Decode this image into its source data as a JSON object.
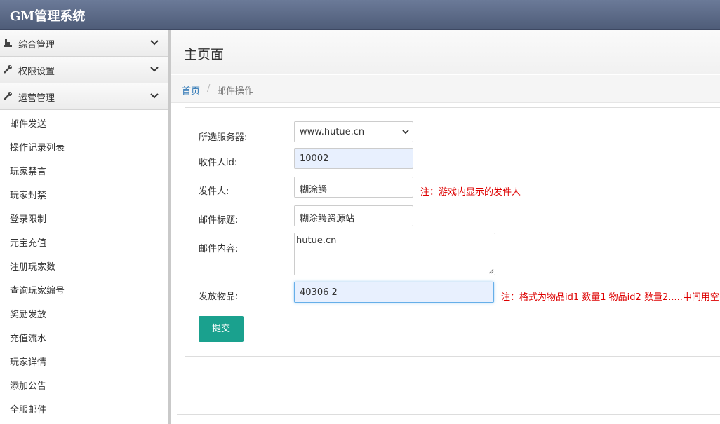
{
  "app": {
    "title": "GM管理系统"
  },
  "sidebar": {
    "groups": [
      {
        "label": "综合管理",
        "icon": "dashboard-icon"
      },
      {
        "label": "权限设置",
        "icon": "wrench-icon"
      },
      {
        "label": "运营管理",
        "icon": "wrench-icon"
      }
    ],
    "items": [
      {
        "label": "邮件发送"
      },
      {
        "label": "操作记录列表"
      },
      {
        "label": "玩家禁言"
      },
      {
        "label": "玩家封禁"
      },
      {
        "label": "登录限制"
      },
      {
        "label": "元宝充值"
      },
      {
        "label": "注册玩家数"
      },
      {
        "label": "查询玩家编号"
      },
      {
        "label": "奖励发放"
      },
      {
        "label": "充值流水"
      },
      {
        "label": "玩家详情"
      },
      {
        "label": "添加公告"
      },
      {
        "label": "全服邮件"
      }
    ]
  },
  "main": {
    "title": "主页面",
    "breadcrumb": {
      "home": "首页",
      "separator": "/",
      "current": "邮件操作"
    }
  },
  "form": {
    "server": {
      "label": "所选服务器:",
      "value": "www.hutue.cn"
    },
    "recipient": {
      "label": "收件人id:",
      "value": "10002"
    },
    "sender": {
      "label": "发件人:",
      "value": "糊涂鳄",
      "note": "注：游戏内显示的发件人"
    },
    "subject": {
      "label": "邮件标题:",
      "value": "糊涂鳄资源站"
    },
    "content": {
      "label": "邮件内容:",
      "value": "hutue.cn"
    },
    "items": {
      "label": "发放物品:",
      "value": "40306 2",
      "note": "注：格式为物品id1 数量1 物品id2 数量2.....中间用空"
    },
    "submit_label": "提交"
  },
  "colors": {
    "accent": "#1aa18e",
    "link": "#337ab7",
    "note": "#dd0000",
    "topbar": "#5a6884"
  }
}
